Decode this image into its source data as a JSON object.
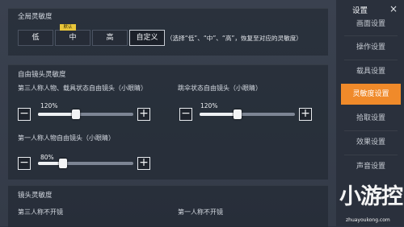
{
  "global": {
    "title": "全局灵敏度",
    "options": [
      "低",
      "中",
      "高",
      "自定义"
    ],
    "selected": "自定义",
    "default_tag": "默认",
    "hint": "（选择“低”、“中”、“高”，恢复至对应的灵敏度）"
  },
  "free_look": {
    "title": "自由镜头灵敏度",
    "tp_vehicle": {
      "label": "第三人称人物、载具状态自由镜头（小眼睛）",
      "value": "120%",
      "level": 0.4
    },
    "parachute": {
      "label": "跳伞状态自由镜头（小眼睛）",
      "value": "120%",
      "level": 0.4
    },
    "fp": {
      "label": "第一人称人物自由镜头（小眼睛）",
      "value": "80%",
      "level": 0.26
    },
    "minus": "−",
    "plus": "+"
  },
  "camera": {
    "title": "镜头灵敏度",
    "tp_no_scope": "第三人称不开镜",
    "fp_no_scope": "第一人称不开镜"
  },
  "sidebar": {
    "title": "设置",
    "close": "×",
    "items": [
      "画面设置",
      "操作设置",
      "载具设置",
      "灵敏度设置",
      "拾取设置",
      "效果设置",
      "声音设置"
    ],
    "active": "灵敏度设置",
    "active_color": "#f08a2a"
  },
  "watermark": {
    "big": "小游控",
    "small": "zhuayoukong.com"
  }
}
